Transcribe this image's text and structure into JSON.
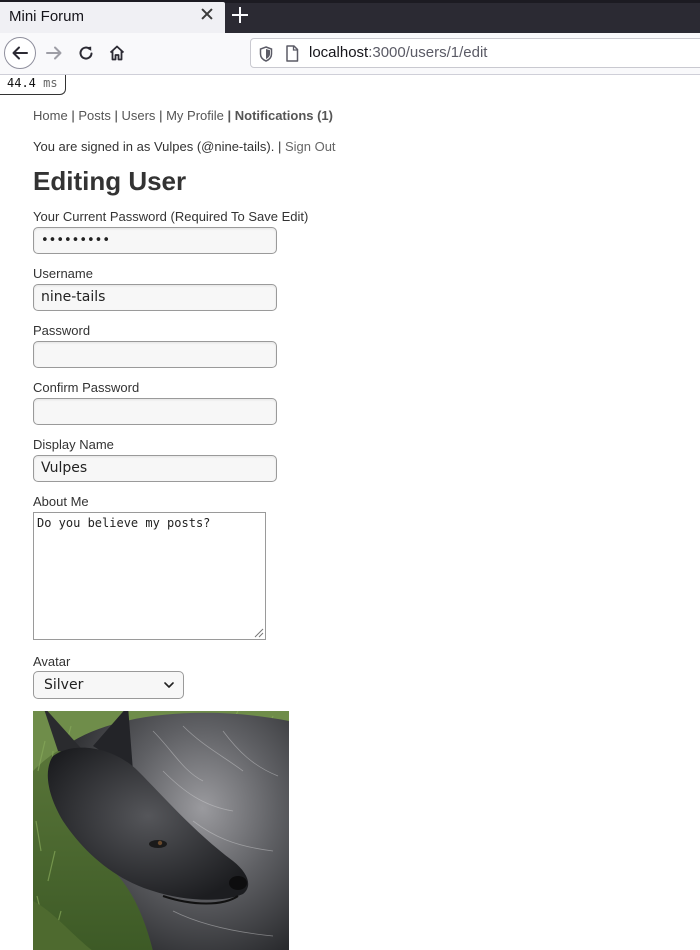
{
  "browser": {
    "tab_title": "Mini Forum",
    "url_host": "localhost",
    "url_rest": ":3000/users/1/edit"
  },
  "timing": {
    "value": "44.4",
    "unit": "ms"
  },
  "nav": {
    "home": "Home",
    "posts": "Posts",
    "users": "Users",
    "my_profile": "My Profile",
    "notifications": "Notifications (1)",
    "sep": "|"
  },
  "session": {
    "text": "You are signed in as Vulpes (@nine-tails).",
    "sign_out": "Sign Out"
  },
  "page_title": "Editing User",
  "form": {
    "current_password": {
      "label": "Your Current Password (Required To Save Edit)",
      "value": "•••••••••"
    },
    "username": {
      "label": "Username",
      "value": "nine-tails"
    },
    "password": {
      "label": "Password",
      "value": ""
    },
    "confirm_password": {
      "label": "Confirm Password",
      "value": ""
    },
    "display_name": {
      "label": "Display Name",
      "value": "Vulpes"
    },
    "about_me": {
      "label": "About Me",
      "value": "Do you believe my posts?"
    },
    "avatar": {
      "label": "Avatar",
      "selected": "Silver"
    }
  },
  "icons": {
    "back": "arrow-left-icon",
    "forward": "arrow-right-icon",
    "reload": "reload-icon",
    "home": "home-icon",
    "shield": "shield-icon",
    "page": "page-icon",
    "close": "close-icon",
    "new_tab": "plus-icon"
  }
}
